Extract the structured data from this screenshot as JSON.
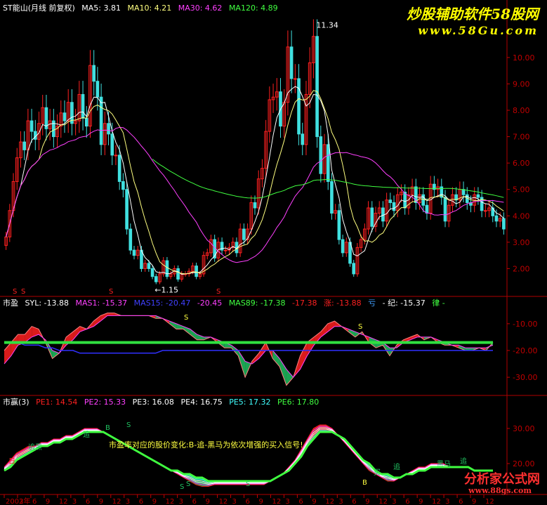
{
  "colors": {
    "bg": "#000000",
    "frame": "#b00000",
    "axis": "#c00000",
    "up": "#ff2020",
    "down": "#40e0e0",
    "white": "#ffffff",
    "ma5": "#ffffff",
    "ma10": "#ffff80",
    "ma30": "#ff40ff",
    "ma120": "#40ff40",
    "red": "#ff2020",
    "green": "#20c060",
    "blue": "#3030ff",
    "violet": "#ff40ff",
    "yellow": "#ffff40",
    "cyan": "#40ffff",
    "watermark": "#ffff00"
  },
  "panels": {
    "main": {
      "header": {
        "name": "ST能山(月线 前复权)",
        "ma5": "MA5: 3.81",
        "ma10": "MA10: 4.21",
        "ma30": "MA30: 4.62",
        "ma120": "MA120: 4.89"
      },
      "markers": {
        "high": "11.34",
        "low": "←1.15",
        "s1": "S",
        "s2": "S",
        "s3": "S",
        "s4": "S"
      }
    },
    "syl": {
      "header": {
        "name": "市盈",
        "syl": "SYL: -13.88",
        "mas1": "MAS1: -15.37",
        "mas15": "MAS15: -20.47",
        "mas45": "-20.45",
        "mas89": "MAS89: -17.38",
        "v6": "-17.38",
        "zhang": "涨: -13.88",
        "yi": "亏",
        "ji": "- 纪: -15.37",
        "lv": "律 -"
      },
      "labels": {
        "b1": "S",
        "b2": "S"
      }
    },
    "pe": {
      "header": {
        "name": "市赢(3)",
        "pe1": "PE1: 14.54",
        "pe2": "PE2: 15.33",
        "pe3": "PE3: 16.08",
        "pe4": "PE4: 16.75",
        "pe5": "PE5: 17.32",
        "pe6": "PE6: 17.80"
      },
      "annotation": "市盈率对应的股价变化:B-追-黑马为依次增强的买入信号!",
      "labels": {
        "a1": "追黑",
        "a2": "追",
        "a3": "B",
        "a4": "S",
        "a5": "S",
        "a6": "S",
        "a7": "B",
        "a8": "追",
        "a9": "黑马",
        "a10": "追",
        "a11": "S",
        "a12": "买",
        "a13": "日"
      }
    }
  },
  "x_axis": [
    "2002年",
    "3",
    "6",
    "9",
    "12",
    "3",
    "6",
    "9",
    "12",
    "3",
    "6",
    "9",
    "12",
    "3",
    "6",
    "9",
    "12",
    "3",
    "6",
    "9",
    "12",
    "3",
    "6",
    "9",
    "12",
    "3",
    "6",
    "9",
    "12",
    "3",
    "6",
    "9",
    "12",
    "3",
    "6",
    "9",
    "12"
  ],
  "watermarks": {
    "top": "炒股辅助软件58股网",
    "url": "www.58Gu.com",
    "bottom": "分析家公式网",
    "bottom_url": "www.88gs.com"
  },
  "chart_data": [
    {
      "type": "candlestick",
      "title": "ST能山(月线 前复权)",
      "ylim": [
        1.0,
        11.7
      ],
      "yticks": [
        2.0,
        3.0,
        4.0,
        5.0,
        6.0,
        7.0,
        8.0,
        9.0,
        10.0
      ],
      "close": [
        3.2,
        4.2,
        5.3,
        6.2,
        6.8,
        6.5,
        7.6,
        7.2,
        6.9,
        7.5,
        8.1,
        7.3,
        7.6,
        7.0,
        7.4,
        7.9,
        7.6,
        8.3,
        7.5,
        7.6,
        8.6,
        7.7,
        7.4,
        9.7,
        9.1,
        8.5,
        6.7,
        7.5,
        7.1,
        6.3,
        6.3,
        5.3,
        5.0,
        3.5,
        2.7,
        2.5,
        2.7,
        2.0,
        2.2,
        2.0,
        1.7,
        1.5,
        1.8,
        2.3,
        1.7,
        1.8,
        2.0,
        1.6,
        1.8,
        1.8,
        1.9,
        2.1,
        1.7,
        1.8,
        2.5,
        2.6,
        3.1,
        2.4,
        3.0,
        2.7,
        2.7,
        2.8,
        3.0,
        2.6,
        3.5,
        3.1,
        3.5,
        4.5,
        4.3,
        5.4,
        5.8,
        7.2,
        8.4,
        8.5,
        8.7,
        7.4,
        8.3,
        10.4,
        9.2,
        9.2,
        7.1,
        6.7,
        8.6,
        9.8,
        10.8,
        7.0,
        5.6,
        6.7,
        5.3,
        4.1,
        4.2,
        3.1,
        2.6,
        3.0,
        2.2,
        1.8,
        2.8,
        3.1,
        3.5,
        4.3,
        3.6,
        4.1,
        4.3,
        3.8,
        4.6,
        4.5,
        4.2,
        4.8,
        4.9,
        4.3,
        4.8,
        5.1,
        4.5,
        4.8,
        4.4,
        4.1,
        5.2,
        5.0,
        5.1,
        4.7,
        3.8,
        4.4,
        4.8,
        4.6,
        5.0,
        4.8,
        4.5,
        4.4,
        4.8,
        4.7,
        4.2,
        4.2,
        4.3,
        4.0,
        3.8,
        3.9,
        3.5
      ],
      "ma_last": {
        "MA5": 3.81,
        "MA10": 4.21,
        "MA30": 4.62,
        "MA120": 4.89
      },
      "high_label": 11.34,
      "low_label": 1.15
    },
    {
      "type": "line",
      "title": "市盈",
      "ylim": [
        -36,
        -4
      ],
      "yticks": [
        -10.0,
        -20.0,
        -30.0
      ],
      "series": [
        {
          "name": "SYL",
          "values": [
            -20,
            -17,
            -14,
            -14,
            -11,
            -12,
            -17,
            -23,
            -21,
            -15,
            -13,
            -11,
            -12,
            -9,
            -7,
            -6,
            -6,
            -7,
            -7,
            -7,
            -7,
            -7,
            -8,
            -8,
            -10,
            -12,
            -12,
            -14,
            -16,
            -16,
            -15,
            -17,
            -19,
            -19,
            -22,
            -30,
            -24,
            -21,
            -17,
            -23,
            -26,
            -33,
            -30,
            -22,
            -17,
            -15,
            -13,
            -10,
            -9,
            -11,
            -13,
            -15,
            -13,
            -17,
            -19,
            -18,
            -22,
            -18,
            -16,
            -15,
            -14,
            -16,
            -15,
            -17,
            -18,
            -18,
            -19,
            -20,
            -20,
            -19,
            -20,
            -17
          ]
        },
        {
          "name": "MAS1",
          "values": [
            -25,
            -22,
            -18,
            -17,
            -15,
            -14,
            -16,
            -20,
            -21,
            -18,
            -16,
            -13,
            -12,
            -11,
            -9,
            -7,
            -7,
            -7,
            -7,
            -7,
            -7,
            -7,
            -7,
            -8,
            -9,
            -10,
            -11,
            -12,
            -14,
            -15,
            -15,
            -16,
            -17,
            -18,
            -20,
            -24,
            -25,
            -23,
            -20,
            -20,
            -23,
            -27,
            -30,
            -27,
            -22,
            -18,
            -15,
            -13,
            -11,
            -11,
            -12,
            -13,
            -14,
            -15,
            -16,
            -17,
            -19,
            -19,
            -17,
            -16,
            -15,
            -15,
            -15,
            -16,
            -17,
            -18,
            -18,
            -19,
            -19,
            -19,
            -19,
            -18
          ]
        },
        {
          "name": "MAS15",
          "values": [
            -17,
            -17,
            -17,
            -18,
            -18,
            -18,
            -19,
            -19,
            -20,
            -20,
            -20,
            -21,
            -21,
            -21,
            -21,
            -21,
            -21,
            -21,
            -21,
            -21,
            -21,
            -21,
            -21,
            -20,
            -20,
            -20,
            -20,
            -20,
            -20,
            -20,
            -20,
            -20,
            -20,
            -20,
            -20,
            -20,
            -20,
            -20,
            -20,
            -20,
            -20,
            -20,
            -20,
            -20,
            -20,
            -20,
            -20,
            -20,
            -20,
            -20,
            -20,
            -20,
            -20,
            -20,
            -20,
            -20,
            -20,
            -20,
            -20,
            -20,
            -20,
            -20,
            -20,
            -20,
            -20,
            -20,
            -20,
            -20,
            -20,
            -20,
            -20,
            -20
          ]
        },
        {
          "name": "MAS89",
          "values": [
            -17,
            -17,
            -17,
            -17,
            -17,
            -17,
            -17,
            -17,
            -17,
            -17,
            -17,
            -17,
            -17,
            -17,
            -17,
            -17,
            -17,
            -17,
            -17,
            -17,
            -17,
            -17,
            -17,
            -17,
            -17,
            -17,
            -17,
            -17,
            -17,
            -17,
            -17,
            -17,
            -17,
            -17,
            -17,
            -17,
            -17,
            -17,
            -17,
            -17,
            -17,
            -17,
            -17,
            -17,
            -17,
            -17,
            -17,
            -17,
            -17,
            -17,
            -17,
            -17,
            -17,
            -17,
            -17,
            -17,
            -17,
            -17,
            -17,
            -17,
            -17,
            -17,
            -17,
            -17,
            -17,
            -17,
            -17,
            -17,
            -17,
            -17,
            -17,
            -17
          ]
        }
      ]
    },
    {
      "type": "line",
      "title": "市赢(3)",
      "ylim": [
        12,
        36
      ],
      "yticks": [
        20.0,
        30.0
      ],
      "series": [
        {
          "name": "PE1",
          "values": [
            19,
            21,
            23,
            24,
            25,
            25,
            26,
            26,
            27,
            27,
            28,
            28,
            29,
            30,
            30,
            30,
            29,
            28,
            27,
            26,
            25,
            24,
            23,
            22,
            21,
            20,
            19,
            18,
            17,
            16,
            15,
            14,
            13.5,
            13.5,
            14,
            14,
            14,
            14,
            14,
            14,
            14,
            14,
            14,
            15,
            16,
            17,
            19,
            21,
            24,
            27,
            30,
            31,
            31,
            30,
            28,
            26,
            24,
            22,
            20,
            18,
            17,
            16,
            15,
            15,
            16,
            17,
            18,
            19,
            19,
            20,
            20,
            20,
            19,
            19,
            19,
            19,
            18,
            18,
            18,
            18
          ]
        },
        {
          "name": "PE6",
          "values": [
            18,
            19,
            21,
            22,
            23,
            24,
            25,
            25,
            26,
            26,
            27,
            27,
            28,
            29,
            29,
            29,
            29,
            28,
            27,
            26,
            25,
            24,
            23,
            22,
            21,
            20,
            19,
            18,
            18,
            17,
            17,
            16,
            16,
            15,
            15,
            15,
            15,
            15,
            15,
            15,
            15,
            15,
            15,
            15,
            16,
            17,
            18,
            20,
            22,
            25,
            27,
            29,
            29,
            29,
            28,
            27,
            25,
            23,
            21,
            20,
            18,
            17,
            17,
            16,
            16,
            17,
            17,
            18,
            18,
            19,
            19,
            19,
            19,
            19,
            19,
            19,
            18,
            18,
            18,
            18
          ]
        }
      ]
    }
  ]
}
